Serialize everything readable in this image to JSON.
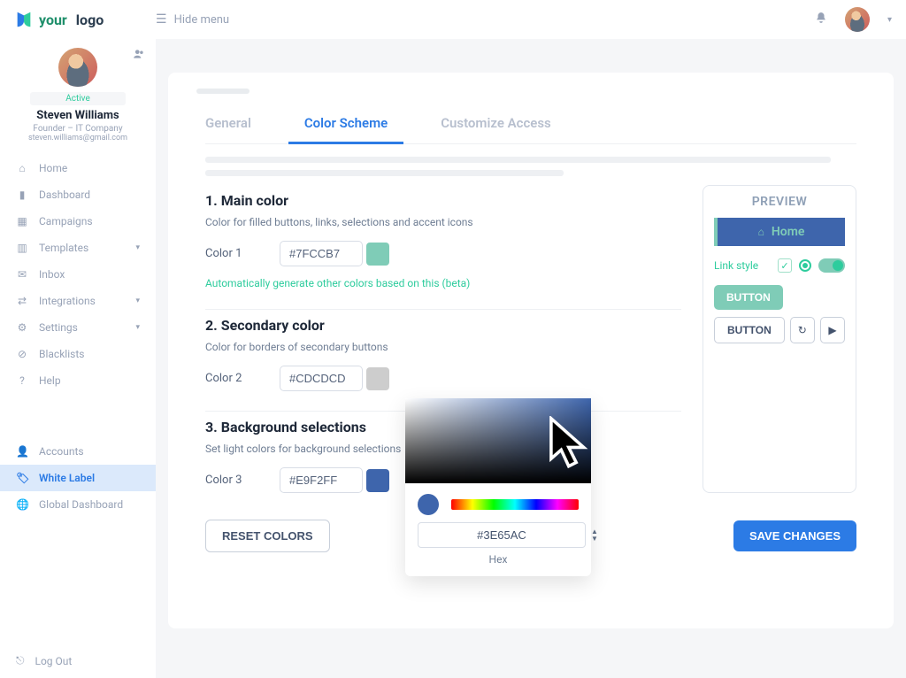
{
  "brand": {
    "word1": "your",
    "word2": "logo"
  },
  "topbar": {
    "hide_menu": "Hide menu",
    "bell_icon": "notification",
    "chev": "▾"
  },
  "profile": {
    "status": "Active",
    "name": "Steven Williams",
    "role": "Founder – IT Company",
    "email": "steven.williams@gmail.com"
  },
  "nav": {
    "home": "Home",
    "dashboard": "Dashboard",
    "campaigns": "Campaigns",
    "templates": "Templates",
    "inbox": "Inbox",
    "integrations": "Integrations",
    "settings": "Settings",
    "blacklists": "Blacklists",
    "help": "Help",
    "accounts": "Accounts",
    "white_label": "White Label",
    "global_dashboard": "Global Dashboard",
    "logout": "Log Out"
  },
  "tabs": {
    "general": "General",
    "color_scheme": "Color Scheme",
    "customize_access": "Customize Access"
  },
  "sections": {
    "s1": {
      "title": "1. Main color",
      "desc": "Color for filled buttons, links, selections and accent icons",
      "label": "Color 1",
      "value": "#7FCCB7",
      "beta": "Automatically generate other colors based on this (beta)"
    },
    "s2": {
      "title": "2. Secondary color",
      "desc": "Color for borders of secondary buttons",
      "label": "Color 2",
      "value": "#CDCDCD"
    },
    "s3": {
      "title": "3. Background selections",
      "desc": "Set light colors for background selections",
      "label": "Color 3",
      "value": "#E9F2FF"
    }
  },
  "preview": {
    "title": "PREVIEW",
    "home": "Home",
    "link_style": "Link style",
    "button1": "BUTTON",
    "button2": "BUTTON"
  },
  "actions": {
    "reset": "RESET COLORS",
    "save": "SAVE CHANGES"
  },
  "picker": {
    "hex": "#3E65AC",
    "label": "Hex"
  },
  "colors": {
    "accent": "#7fccb7",
    "secondary": "#cdcdcd",
    "bg_selection": "#e9f2ff",
    "primary_blue": "#2c7be5",
    "preview_dark": "#3e65ac"
  }
}
